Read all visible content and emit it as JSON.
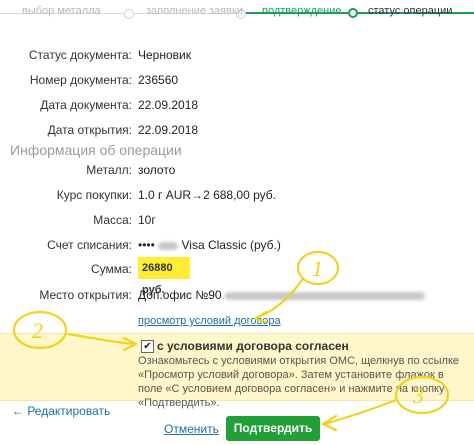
{
  "steps": [
    {
      "label": "выбор металла"
    },
    {
      "label": "заполнение заявки"
    },
    {
      "label": "подтверждение"
    },
    {
      "label": "статус операции"
    }
  ],
  "document": {
    "status_label": "Статус документа:",
    "status_value": "Черновик",
    "number_label": "Номер документа:",
    "number_value": "236560",
    "date_label": "Дата документа:",
    "date_value": "22.09.2018",
    "open_date_label": "Дата открытия:",
    "open_date_value": "22.09.2018"
  },
  "operation": {
    "section_title": "Информация об операции",
    "metal_label": "Металл:",
    "metal_value": "золото",
    "rate_label": "Курс покупки:",
    "rate_value": "1.0 г  AUR→2 688,00  руб.",
    "mass_label": "Масса:",
    "mass_value": "10г",
    "account_label": "Счет списания:",
    "account_value": "•••• ",
    "account_card": "Visa Classic  (руб.)",
    "sum_label": "Сумма:",
    "sum_value": "26880  руб.",
    "place_label": "Место открытия:",
    "place_value": "Доп.офис №90"
  },
  "terms": {
    "link": "просмотр условий договора",
    "checkbox_label": "с условиями договора согласен",
    "checkbox_mark": "✔",
    "hint": "Ознакомьтесь с условиями открытия ОМС, щелкнув по ссылке «Просмотр условий договора». Затем установите флажок в поле «С условием договора согласен» и нажмите на кнопку «Подтвердить»."
  },
  "actions": {
    "edit": "← Редактировать",
    "cancel": "Отменить",
    "confirm": "Подтвердить"
  },
  "annotations": [
    "1",
    "2",
    "3"
  ],
  "colors": {
    "accent": "#21a038",
    "link": "#1d6fa5",
    "highlight": "#ffee33",
    "notice_bg": "#fff7c9"
  }
}
